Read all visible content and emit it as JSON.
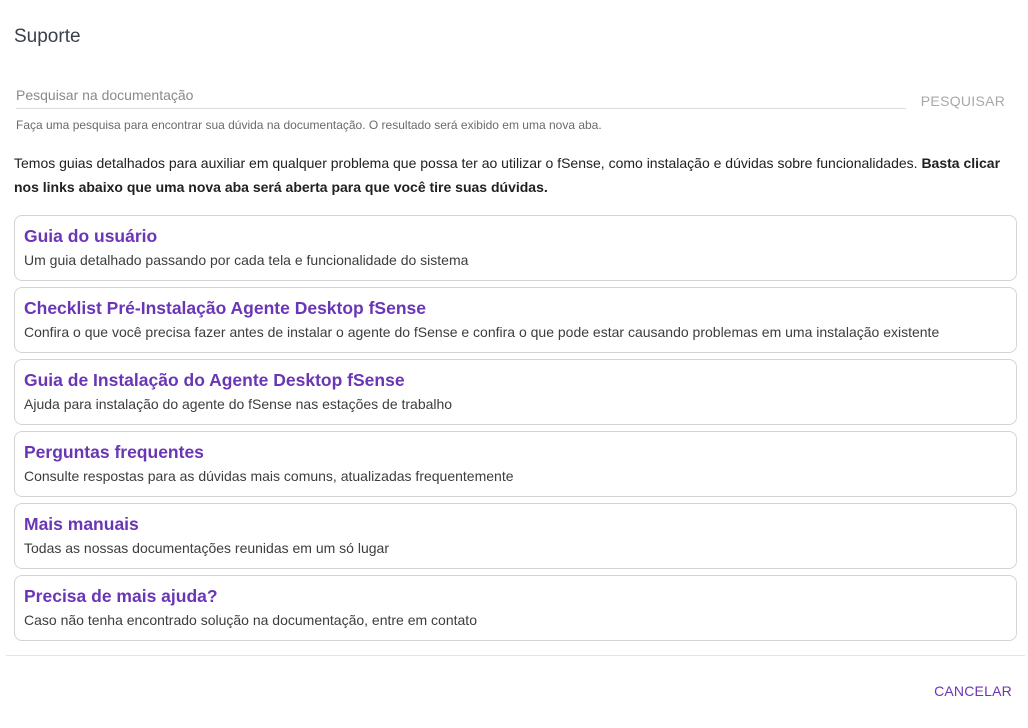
{
  "dialog": {
    "title": "Suporte"
  },
  "search": {
    "placeholder": "Pesquisar na documentação",
    "value": "",
    "hint": "Faça uma pesquisa para encontrar sua dúvida na documentação. O resultado será exibido em uma nova aba.",
    "button_label": "PESQUISAR"
  },
  "intro": {
    "text": "Temos guias detalhados para auxiliar em qualquer problema que possa ter ao utilizar o fSense, como instalação e dúvidas sobre funcionalidades. ",
    "bold": "Basta clicar nos links abaixo que uma nova aba será aberta para que você tire suas dúvidas."
  },
  "links": [
    {
      "title": "Guia do usuário",
      "description": "Um guia detalhado passando por cada tela e funcionalidade do sistema"
    },
    {
      "title": "Checklist Pré-Instalação Agente Desktop fSense",
      "description": "Confira o que você precisa fazer antes de instalar o agente do fSense e confira o que pode estar causando problemas em uma instalação existente"
    },
    {
      "title": "Guia de Instalação do Agente Desktop fSense",
      "description": "Ajuda para instalação do agente do fSense nas estações de trabalho"
    },
    {
      "title": "Perguntas frequentes",
      "description": "Consulte respostas para as dúvidas mais comuns, atualizadas frequentemente"
    },
    {
      "title": "Mais manuais",
      "description": "Todas as nossas documentações reunidas em um só lugar"
    },
    {
      "title": "Precisa de mais ajuda?",
      "description": "Caso não tenha encontrado solução na documentação, entre em contato"
    }
  ],
  "footer": {
    "cancel_label": "CANCELAR"
  },
  "colors": {
    "accent": "#6a36b5",
    "disabled_button": "#a8a8a8",
    "card_border": "#d4d4d4"
  }
}
